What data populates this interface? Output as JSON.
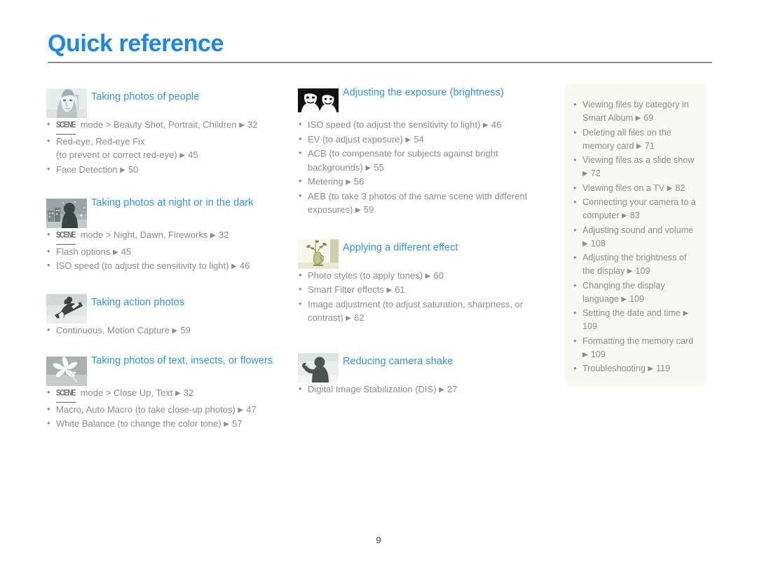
{
  "page": {
    "title": "Quick reference",
    "number": "9",
    "accent_color": "#2e94f4",
    "title_color": "#1a86f0",
    "rule_color": "#958e8b",
    "body_text_color": "#8d8d8d",
    "sidebar_bg_color": "#faf8f2",
    "arrow_glyph": "▶",
    "bullet_glyph": "•",
    "scene_label": "SCENE"
  },
  "columns": {
    "left": [
      {
        "id": "taking-photos-of-people",
        "icon": "portrait-woman-icon",
        "title": "Taking photos of people",
        "items": [
          {
            "scene": true,
            "text": "mode > Beauty Shot, Portrait, Children",
            "arrow": "▶",
            "page": "32"
          },
          {
            "text": "Red-eye, Red-eye Fix",
            "sub": "(to prevent or correct red-eye)",
            "arrow": "▶",
            "page": "45"
          },
          {
            "text": "Face Detection",
            "arrow": "▶",
            "page": "50"
          }
        ]
      },
      {
        "id": "taking-photos-at-night",
        "icon": "night-scene-icon",
        "title": "Taking photos at night or in the dark",
        "items": [
          {
            "scene": true,
            "text": "mode > Night, Dawn, Fireworks",
            "arrow": "▶",
            "page": "32"
          },
          {
            "text": "Flash options",
            "arrow": "▶",
            "page": "45"
          },
          {
            "text": "ISO speed (to adjust the sensitivity to light)",
            "arrow": "▶",
            "page": "46"
          }
        ]
      },
      {
        "id": "taking-action-photos",
        "icon": "snowboarder-icon",
        "title": "Taking action photos",
        "items": [
          {
            "text": "Continuous, Motion Capture",
            "arrow": "▶",
            "page": "59"
          }
        ]
      },
      {
        "id": "taking-photos-of-text-insects-flowers",
        "icon": "flower-macro-icon",
        "title": "Taking photos of text, insects, or flowers",
        "items": [
          {
            "scene": true,
            "text": "mode > Close Up, Text",
            "arrow": "▶",
            "page": "32"
          },
          {
            "text": "Macro, Auto Macro (to take close-up photos)",
            "arrow": "▶",
            "page": "47"
          },
          {
            "text": "White Balance (to change the color tone)",
            "arrow": "▶",
            "page": "57"
          }
        ]
      }
    ],
    "middle": [
      {
        "id": "adjusting-the-exposure",
        "icon": "two-faces-bw-icon",
        "title": "Adjusting the exposure (brightness)",
        "items": [
          {
            "text": "ISO speed (to adjust the sensitivity to light)",
            "arrow": "▶",
            "page": "46"
          },
          {
            "text": "EV (to adjust exposure)",
            "arrow": "▶",
            "page": "54"
          },
          {
            "text": "ACB (to compensate for subjects against bright backgrounds)",
            "arrow": "▶",
            "page": "55"
          },
          {
            "text": "Metering",
            "arrow": "▶",
            "page": "56"
          },
          {
            "text": "AEB (to take 3 photos of the same scene with different exposures)",
            "arrow": "▶",
            "page": "59"
          }
        ]
      },
      {
        "id": "applying-a-different-effect",
        "icon": "flower-vase-icon",
        "title": "Applying a different effect",
        "items": [
          {
            "text": "Photo styles (to apply tones)",
            "arrow": "▶",
            "page": "60"
          },
          {
            "text": "Smart Filter effects",
            "arrow": "▶",
            "page": "61"
          },
          {
            "text": "Image adjustment (to adjust saturation, sharpness, or contrast)",
            "arrow": "▶",
            "page": "62"
          }
        ]
      },
      {
        "id": "reducing-camera-shake",
        "icon": "person-waving-icon",
        "title": "Reducing camera shake",
        "items": [
          {
            "text": "Digital Image Stabilization (DIS)",
            "arrow": "▶",
            "page": "27"
          }
        ]
      }
    ],
    "right": {
      "id": "playback-and-settings-box",
      "items": [
        {
          "text": "Viewing files by category in Smart Album",
          "arrow": "▶",
          "page": "69"
        },
        {
          "text": "Deleting all files on the memory card",
          "arrow": "▶",
          "page": "71"
        },
        {
          "text": "Viewing files as a slide show",
          "arrow": "▶",
          "page": "72"
        },
        {
          "text": "Viewing files on a TV",
          "arrow": "▶",
          "page": "82"
        },
        {
          "text": "Connecting your camera to a computer",
          "arrow": "▶",
          "page": "83"
        },
        {
          "text": "Adjusting sound and volume",
          "arrow": "▶",
          "page": "108"
        },
        {
          "text": "Adjusting the brightness of the display",
          "arrow": "▶",
          "page": "109"
        },
        {
          "text": "Changing the display language",
          "arrow": "▶",
          "page": "109"
        },
        {
          "text": "Setting the date and time",
          "arrow": "▶",
          "page": "109"
        },
        {
          "text": "Formatting the memory card",
          "arrow": "▶",
          "page": "109"
        },
        {
          "text": "Troubleshooting",
          "arrow": "▶",
          "page": "119"
        }
      ]
    }
  }
}
